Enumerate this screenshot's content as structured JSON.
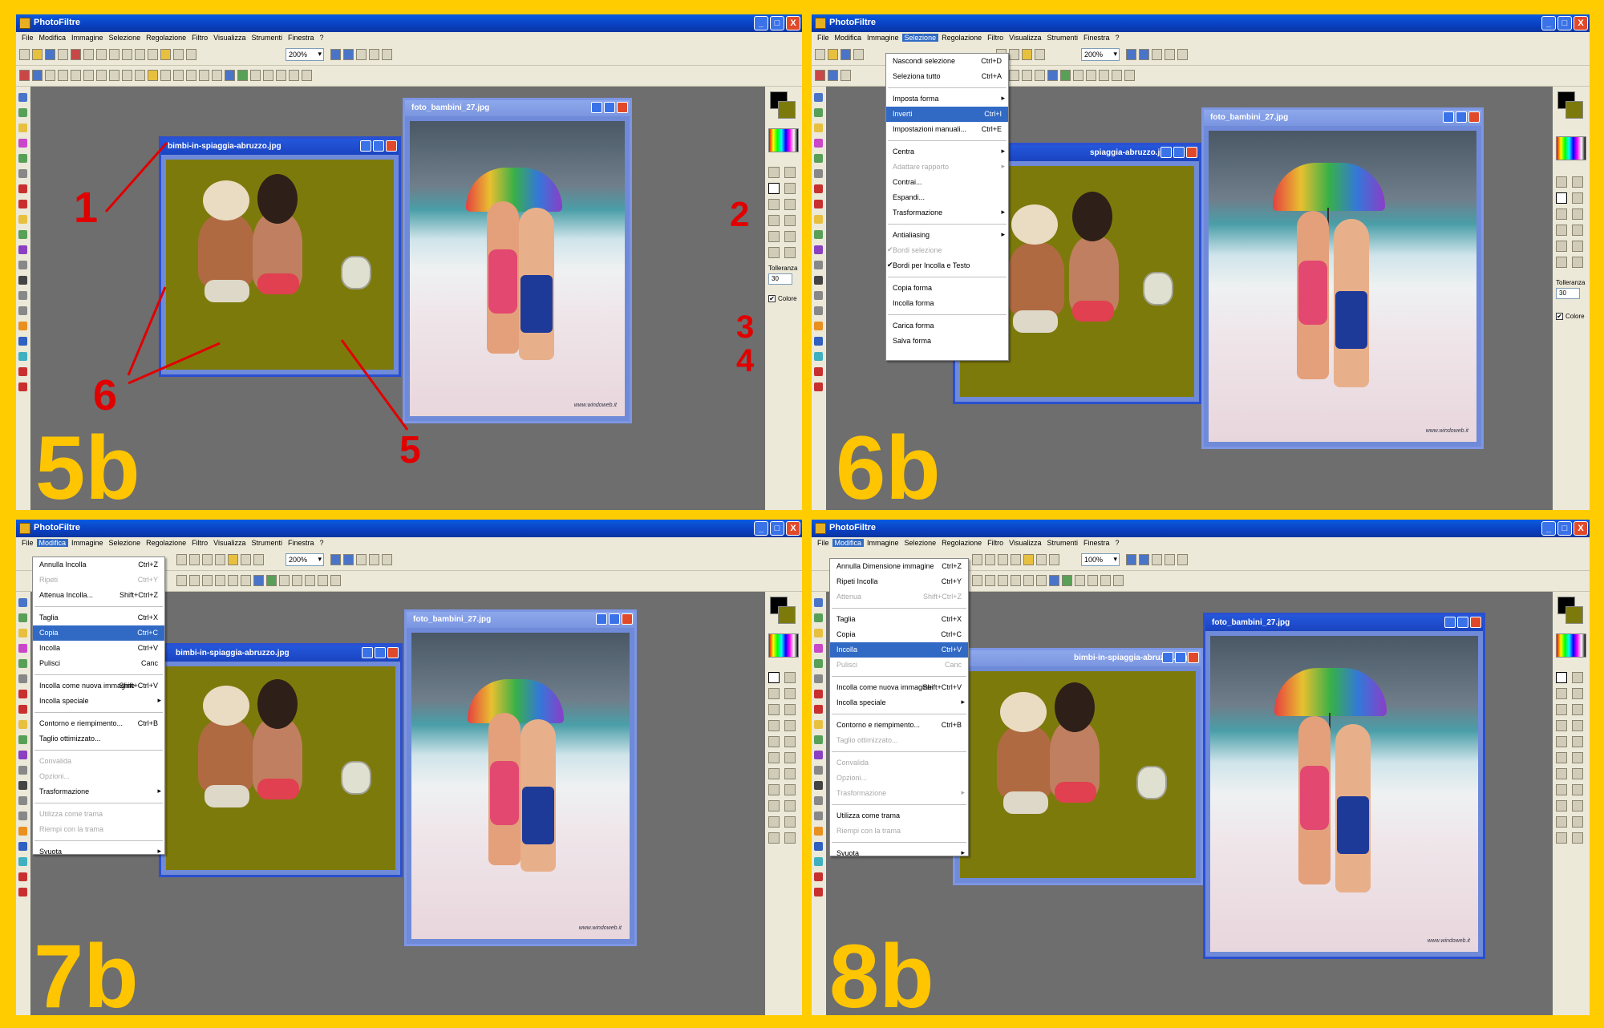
{
  "app_title": "PhotoFiltre",
  "window_controls": {
    "minimize": "_",
    "maximize": "□",
    "close": "X"
  },
  "menu_bar": [
    "File",
    "Modifica",
    "Immagine",
    "Selezione",
    "Regolazione",
    "Filtro",
    "Visualizza",
    "Strumenti",
    "Finestra",
    "?"
  ],
  "docs": {
    "bimbi": "bimbi-in-spiaggia-abruzzo.jpg",
    "bimbi_partial": "bimbi-in-spiaggia-abruzzo.jpg",
    "bimbi_partial_6b": "spiaggia-abruzzo.jpg",
    "bimbi_partial_8b": "bimbi-in-spiaggia-abruzzo.jpg",
    "foto": "foto_bambini_27.jpg"
  },
  "watermark": "www.windoweb.it",
  "right_panel": {
    "tolleranza_label": "Tolleranza",
    "tolleranza_value": "30",
    "colore_label": "Colore",
    "colore_check": "✔"
  },
  "panels": [
    {
      "step": "5b",
      "zoom": "200%",
      "menu_active": ""
    },
    {
      "step": "6b",
      "zoom": "200%",
      "menu_active": "Selezione"
    },
    {
      "step": "7b",
      "zoom": "200%",
      "menu_active": "Modifica"
    },
    {
      "step": "8b",
      "zoom": "100%",
      "menu_active": "Modifica"
    }
  ],
  "annotations": {
    "n1": "1",
    "n2": "2",
    "n3": "3",
    "n4": "4",
    "n5": "5",
    "n6": "6"
  },
  "selezione_menu": [
    {
      "label": "Nascondi selezione",
      "shortcut": "Ctrl+D"
    },
    {
      "label": "Seleziona tutto",
      "shortcut": "Ctrl+A"
    },
    {
      "sep": true
    },
    {
      "label": "Imposta forma",
      "shortcut": "",
      "submenu": true
    },
    {
      "label": "Inverti",
      "shortcut": "Ctrl+I",
      "highlight": true
    },
    {
      "label": "Impostazioni manuali...",
      "shortcut": "Ctrl+E"
    },
    {
      "sep": true
    },
    {
      "label": "Centra",
      "shortcut": "",
      "submenu": true
    },
    {
      "label": "Adattare rapporto",
      "shortcut": "",
      "submenu": true,
      "disabled": true
    },
    {
      "label": "Contrai...",
      "shortcut": ""
    },
    {
      "label": "Espandi...",
      "shortcut": ""
    },
    {
      "label": "Trasformazione",
      "shortcut": "",
      "submenu": true
    },
    {
      "sep": true
    },
    {
      "label": "Antialiasing",
      "shortcut": "",
      "submenu": true
    },
    {
      "label": "Bordi selezione",
      "shortcut": "",
      "checked": true,
      "disabled": true
    },
    {
      "label": "Bordi per Incolla e Testo",
      "shortcut": "",
      "checked": true
    },
    {
      "sep": true
    },
    {
      "label": "Copia forma",
      "shortcut": ""
    },
    {
      "label": "Incolla forma",
      "shortcut": ""
    },
    {
      "sep": true
    },
    {
      "label": "Carica forma",
      "shortcut": ""
    },
    {
      "label": "Salva forma",
      "shortcut": ""
    }
  ],
  "modifica_menu_7b": [
    {
      "label": "Annulla Incolla",
      "shortcut": "Ctrl+Z"
    },
    {
      "label": "Ripeti",
      "shortcut": "Ctrl+Y",
      "disabled": true
    },
    {
      "label": "Attenua Incolla...",
      "shortcut": "Shift+Ctrl+Z"
    },
    {
      "sep": true
    },
    {
      "label": "Taglia",
      "shortcut": "Ctrl+X"
    },
    {
      "label": "Copia",
      "shortcut": "Ctrl+C",
      "highlight": true
    },
    {
      "label": "Incolla",
      "shortcut": "Ctrl+V"
    },
    {
      "label": "Pulisci",
      "shortcut": "Canc"
    },
    {
      "sep": true
    },
    {
      "label": "Incolla come nuova immagine",
      "shortcut": "Shift+Ctrl+V"
    },
    {
      "label": "Incolla speciale",
      "shortcut": "",
      "submenu": true
    },
    {
      "sep": true
    },
    {
      "label": "Contorno e riempimento...",
      "shortcut": "Ctrl+B"
    },
    {
      "label": "Taglio ottimizzato...",
      "shortcut": ""
    },
    {
      "sep": true
    },
    {
      "label": "Convalida",
      "shortcut": "",
      "disabled": true
    },
    {
      "label": "Opzioni...",
      "shortcut": "",
      "disabled": true
    },
    {
      "label": "Trasformazione",
      "shortcut": "",
      "submenu": true
    },
    {
      "sep": true
    },
    {
      "label": "Utilizza come trama",
      "shortcut": "",
      "disabled": true
    },
    {
      "label": "Riempi con la trama",
      "shortcut": "",
      "disabled": true
    },
    {
      "sep": true
    },
    {
      "label": "Svuota",
      "shortcut": "",
      "submenu": true
    }
  ],
  "modifica_menu_8b": [
    {
      "label": "Annulla Dimensione immagine",
      "shortcut": "Ctrl+Z"
    },
    {
      "label": "Ripeti Incolla",
      "shortcut": "Ctrl+Y"
    },
    {
      "label": "Attenua",
      "shortcut": "Shift+Ctrl+Z",
      "disabled": true
    },
    {
      "sep": true
    },
    {
      "label": "Taglia",
      "shortcut": "Ctrl+X"
    },
    {
      "label": "Copia",
      "shortcut": "Ctrl+C"
    },
    {
      "label": "Incolla",
      "shortcut": "Ctrl+V",
      "highlight": true
    },
    {
      "label": "Pulisci",
      "shortcut": "Canc",
      "disabled": true
    },
    {
      "sep": true
    },
    {
      "label": "Incolla come nuova immagine",
      "shortcut": "Shift+Ctrl+V"
    },
    {
      "label": "Incolla speciale",
      "shortcut": "",
      "submenu": true
    },
    {
      "sep": true
    },
    {
      "label": "Contorno e riempimento...",
      "shortcut": "Ctrl+B"
    },
    {
      "label": "Taglio ottimizzato...",
      "shortcut": "",
      "disabled": true
    },
    {
      "sep": true
    },
    {
      "label": "Convalida",
      "shortcut": "",
      "disabled": true
    },
    {
      "label": "Opzioni...",
      "shortcut": "",
      "disabled": true
    },
    {
      "label": "Trasformazione",
      "shortcut": "",
      "submenu": true,
      "disabled": true
    },
    {
      "sep": true
    },
    {
      "label": "Utilizza come trama",
      "shortcut": ""
    },
    {
      "label": "Riempi con la trama",
      "shortcut": "",
      "disabled": true
    },
    {
      "sep": true
    },
    {
      "label": "Svuota",
      "shortcut": "",
      "submenu": true
    }
  ],
  "colors": {
    "background": "#ffcc00",
    "workspace": "#6e6e6e",
    "olive": "#7d7a0c",
    "titlebar": "#0a4fd8",
    "highlight": "#316ac5",
    "annotation": "#e00000",
    "step_label": "#ffc500"
  },
  "icons": [
    "new-file-icon",
    "open-icon",
    "save-icon",
    "print-icon",
    "undo-icon",
    "redo-icon",
    "zoom-in-icon",
    "zoom-out-icon",
    "magic-wand-icon",
    "pipette-icon",
    "brush-icon",
    "fill-icon",
    "eraser-icon",
    "selection-arrow-icon"
  ]
}
